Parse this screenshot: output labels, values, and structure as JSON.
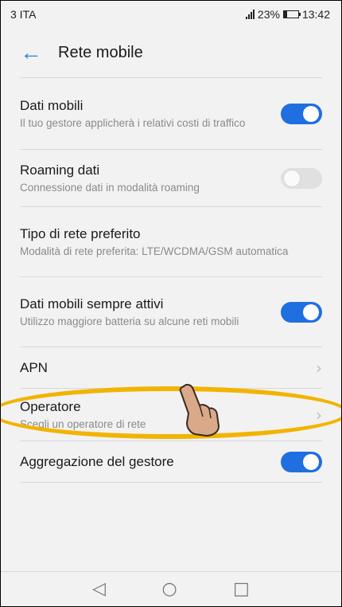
{
  "status_bar": {
    "carrier": "3 ITA",
    "battery": "23%",
    "time": "13:42"
  },
  "header": {
    "back_icon": "arrow-left-icon",
    "title": "Rete mobile"
  },
  "settings": [
    {
      "label": "Dati mobili",
      "sub": "Il tuo gestore applicherà i relativi costi di traffico",
      "control": "toggle",
      "state": "on"
    },
    {
      "label": "Roaming dati",
      "sub": "Connessione dati in modalità roaming",
      "control": "toggle",
      "state": "off"
    },
    {
      "label": "Tipo di rete preferito",
      "sub": "Modalità di rete preferita: LTE/WCDMA/GSM automatica",
      "control": "none"
    },
    {
      "label": "Dati mobili sempre attivi",
      "sub": "Utilizzo maggiore batteria su alcune reti mobili",
      "control": "toggle",
      "state": "on"
    },
    {
      "label": "APN",
      "control": "chevron"
    },
    {
      "label": "Operatore",
      "sub": "Scegli un operatore di rete",
      "control": "chevron"
    },
    {
      "label": "Aggregazione del gestore",
      "control": "toggle",
      "state": "on"
    }
  ],
  "nav": {
    "back": "◁",
    "home": "○",
    "recent": "□"
  },
  "colors": {
    "accent": "#1f6fe0",
    "highlight": "#f2b400"
  }
}
